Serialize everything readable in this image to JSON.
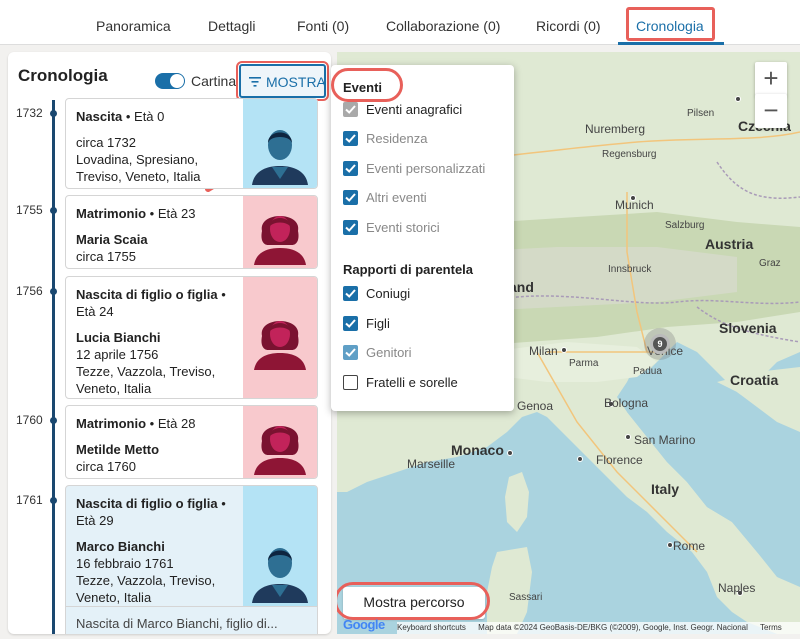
{
  "tabs": [
    {
      "label": "Panoramica"
    },
    {
      "label": "Dettagli"
    },
    {
      "label": "Fonti (0)"
    },
    {
      "label": "Collaborazione (0)"
    },
    {
      "label": "Ricordi (0)"
    },
    {
      "label": "Cronologia",
      "active": true
    }
  ],
  "panel": {
    "title": "Cronologia",
    "toggle_label": "Cartina",
    "toggle_on": true,
    "filter_button": "MOSTRA"
  },
  "timeline": [
    {
      "year": "1732",
      "event": "Nascita",
      "age": " • Età 0",
      "person": "",
      "lines": [
        "circa 1732",
        "Lovadina, Spresiano,",
        "Treviso, Veneto, Italia"
      ],
      "gender": "male"
    },
    {
      "year": "1755",
      "event": "Matrimonio",
      "age": " • Età 23",
      "person": "Maria Scaia",
      "lines": [
        "circa 1755"
      ],
      "gender": "female"
    },
    {
      "year": "1756",
      "event": "Nascita di figlio o figlia",
      "age": " • Età 24",
      "person": "Lucia Bianchi",
      "lines": [
        "12 aprile 1756",
        "Tezze, Vazzola, Treviso,",
        "Veneto, Italia"
      ],
      "gender": "female"
    },
    {
      "year": "1760",
      "event": "Matrimonio",
      "age": " • Età 28",
      "person": "Metilde Metto",
      "lines": [
        "circa 1760"
      ],
      "gender": "female"
    },
    {
      "year": "1761",
      "event": "Nascita di figlio o figlia",
      "age": " • Età 29",
      "person": "Marco Bianchi",
      "lines": [
        "16 febbraio 1761",
        "Tezze, Vazzola, Treviso,",
        "Veneto, Italia"
      ],
      "gender": "male",
      "selected": true
    }
  ],
  "next_card_partial": "Nascita di Marco Bianchi, figlio di...",
  "dropdown": {
    "events_heading": "Eventi",
    "events": [
      {
        "label": "Eventi anagrafici",
        "state": "disabled",
        "active": true
      },
      {
        "label": "Residenza",
        "state": "checked",
        "active": false
      },
      {
        "label": "Eventi personalizzati",
        "state": "checked",
        "active": false
      },
      {
        "label": "Altri eventi",
        "state": "checked",
        "active": false
      },
      {
        "label": "Eventi storici",
        "state": "checked",
        "active": false
      }
    ],
    "relations_heading": "Rapporti di parentela",
    "relations": [
      {
        "label": "Coniugi",
        "state": "checked",
        "active": true
      },
      {
        "label": "Figli",
        "state": "checked",
        "active": true
      },
      {
        "label": "Genitori",
        "state": "disabled",
        "active": false
      },
      {
        "label": "Fratelli e sorelle",
        "state": "unchecked",
        "active": true
      }
    ]
  },
  "map": {
    "zoom_in": "+",
    "zoom_out": "−",
    "cluster_count": "9",
    "route_button": "Mostra percorso",
    "google_logo": "Google",
    "attribution": [
      "Keyboard shortcuts",
      "Map data ©2024 GeoBasis-DE/BKG (©2009), Google, Inst. Geogr. Nacional",
      "Terms"
    ],
    "labels": [
      {
        "text": "Czechia",
        "kind": "country"
      },
      {
        "text": "Nuremberg",
        "kind": "city"
      },
      {
        "text": "Pilsen",
        "kind": "small"
      },
      {
        "text": "Regensburg",
        "kind": "small"
      },
      {
        "text": "Munich",
        "kind": "city"
      },
      {
        "text": "Salzburg",
        "kind": "small"
      },
      {
        "text": "Austria",
        "kind": "country"
      },
      {
        "text": "Innsbruck",
        "kind": "small"
      },
      {
        "text": "Graz",
        "kind": "small"
      },
      {
        "text": "and",
        "kind": "country"
      },
      {
        "text": "Slovenia",
        "kind": "country"
      },
      {
        "text": "Milan",
        "kind": "city"
      },
      {
        "text": "Venice",
        "kind": "city"
      },
      {
        "text": "Croatia",
        "kind": "country"
      },
      {
        "text": "Bologna",
        "kind": "city"
      },
      {
        "text": "Genoa",
        "kind": "city"
      },
      {
        "text": "Monaco",
        "kind": "country"
      },
      {
        "text": "San Marino",
        "kind": "city"
      },
      {
        "text": "Florence",
        "kind": "city"
      },
      {
        "text": "Marseille",
        "kind": "city"
      },
      {
        "text": "Italy",
        "kind": "country"
      },
      {
        "text": "Rome",
        "kind": "city"
      },
      {
        "text": "Naples",
        "kind": "city"
      },
      {
        "text": "Padua",
        "kind": "small"
      },
      {
        "text": "Parma",
        "kind": "small"
      },
      {
        "text": "Sassari",
        "kind": "small"
      }
    ]
  }
}
